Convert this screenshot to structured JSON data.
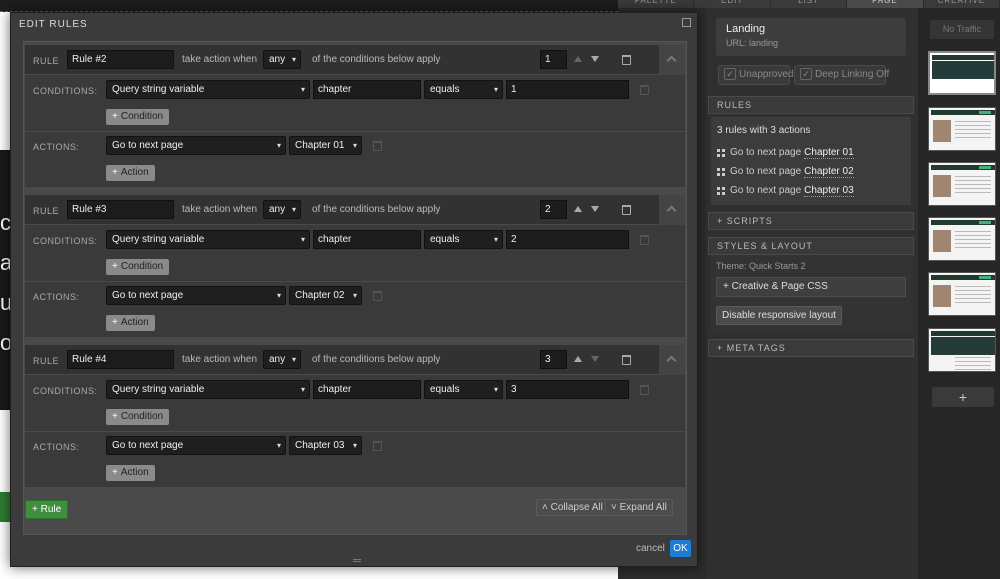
{
  "background": {
    "letters": [
      "c",
      "a",
      "u",
      "o"
    ],
    "tabs": [
      "PALETTE",
      "EDIT",
      "LIST",
      "PAGE",
      "CREATIVE"
    ]
  },
  "side": {
    "landing_title": "Landing",
    "landing_url": "URL: landing",
    "unapproved": "Unapproved",
    "deep_linking": "Deep Linking Off",
    "rules_header": "RULES",
    "rules_summary": "3 rules with 3 actions",
    "rule_lines": [
      {
        "text": "Go to next page",
        "target": "Chapter 01"
      },
      {
        "text": "Go to next page",
        "target": "Chapter 02"
      },
      {
        "text": "Go to next page",
        "target": "Chapter 03"
      }
    ],
    "scripts": "+ SCRIPTS",
    "styles_header": "STYLES & LAYOUT",
    "theme": "Theme: Quick Starts 2",
    "creative_css": "+ Creative & Page CSS",
    "responsive": "Disable responsive layout",
    "meta_tags": "+ META TAGS",
    "no_traffic": "No Traffic",
    "add_variant": "+"
  },
  "modal": {
    "title": "EDIT RULES",
    "rule_label": "RULE",
    "take_action": "take action when",
    "of_conditions": "of the conditions below apply",
    "conditions_label": "CONDITIONS:",
    "actions_label": "ACTIONS:",
    "add_condition": "Condition",
    "add_action": "Action",
    "rules": [
      {
        "name": "Rule #2",
        "match": "any",
        "order": "1",
        "variable": "Query string variable",
        "key": "chapter",
        "operator": "equals",
        "value": "1",
        "action": "Go to next page",
        "target": "Chapter 01"
      },
      {
        "name": "Rule #3",
        "match": "any",
        "order": "2",
        "variable": "Query string variable",
        "key": "chapter",
        "operator": "equals",
        "value": "2",
        "action": "Go to next page",
        "target": "Chapter 02"
      },
      {
        "name": "Rule #4",
        "match": "any",
        "order": "3",
        "variable": "Query string variable",
        "key": "chapter",
        "operator": "equals",
        "value": "3",
        "action": "Go to next page",
        "target": "Chapter 03"
      }
    ],
    "add_rule": "+ Rule",
    "collapse_all": "Collapse All",
    "expand_all": "Expand All",
    "cancel": "cancel",
    "ok": "OK"
  },
  "colors": {
    "accent_blue": "#1e7bd6",
    "accent_green": "#3f8f3f"
  }
}
